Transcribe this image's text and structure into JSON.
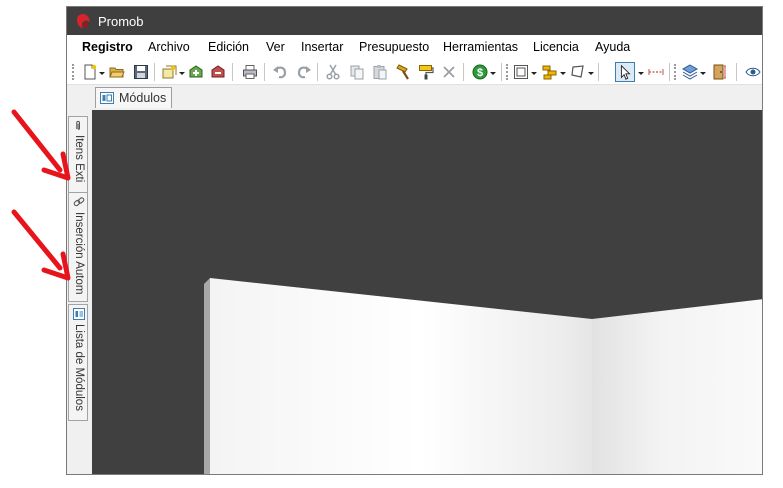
{
  "window": {
    "title": "Promob"
  },
  "menu": {
    "items": [
      "Registro",
      "Archivo",
      "Edición",
      "Ver",
      "Insertar",
      "Presupuesto",
      "Herramientas",
      "Licencia",
      "Ayuda"
    ]
  },
  "toolbar": {
    "icons": [
      "new-document-icon",
      "open-folder-icon",
      "save-icon",
      "insert-icon",
      "import-icon",
      "export-icon",
      "print-icon",
      "undo-icon",
      "redo-icon",
      "cut-icon",
      "copy-icon",
      "paste-icon",
      "hammer-icon",
      "paint-roller-icon",
      "delete-icon",
      "budget-dollar-icon",
      "frame-icon",
      "layers-group-icon",
      "shape-icon",
      "select-cursor-icon",
      "measure-icon",
      "layers-icon",
      "door-icon",
      "view-eye-icon"
    ]
  },
  "tabs": {
    "modulos": "Módulos"
  },
  "side_tabs": [
    {
      "label": "Itens Exti",
      "icon": "paperclip-icon"
    },
    {
      "label": "Inserción Autom",
      "icon": "chain-link-icon"
    },
    {
      "label": "Lista de Módulos",
      "icon": "module-list-icon"
    }
  ],
  "colors": {
    "titlebar": "#3f3f3f",
    "viewport": "#404040",
    "annotation_arrow": "#e8141c",
    "logo": "#d9232a"
  }
}
